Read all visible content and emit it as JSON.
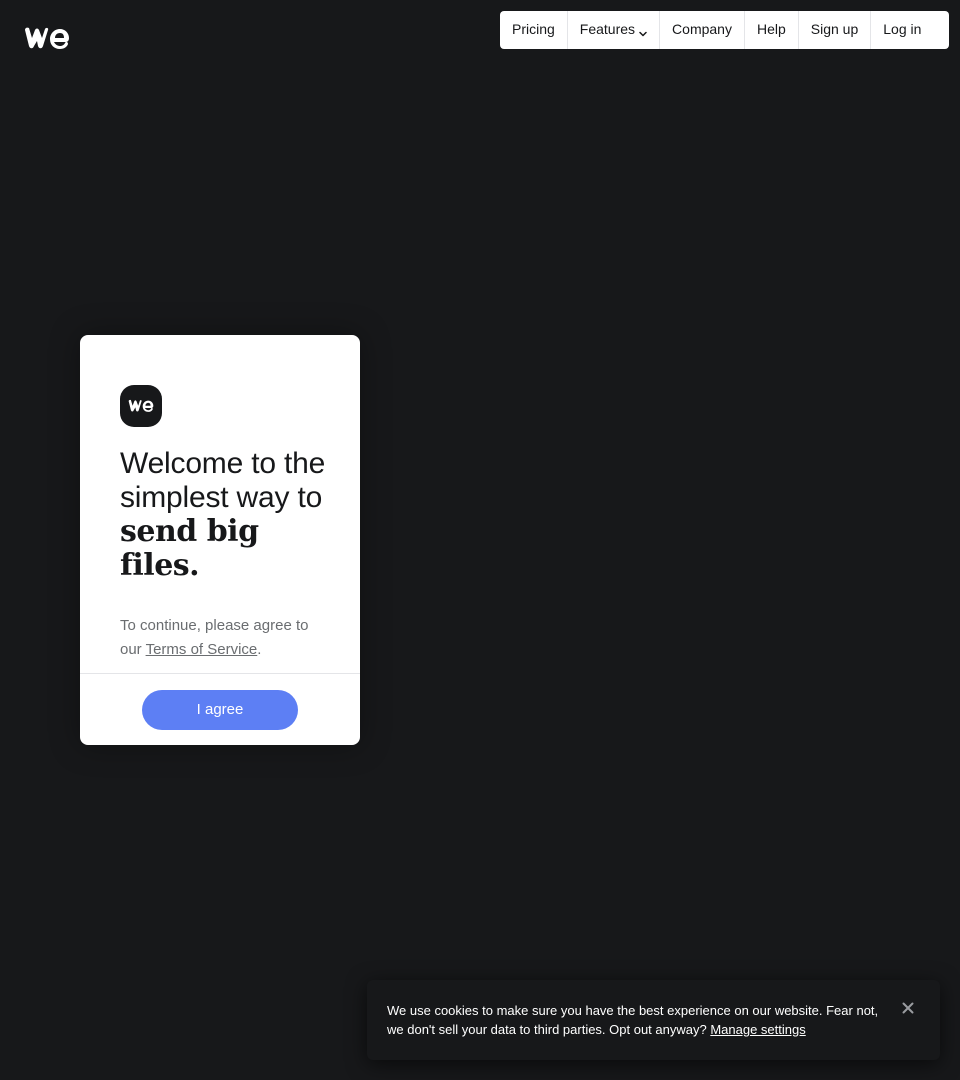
{
  "brand": {
    "logo_icon": "wetransfer-logo"
  },
  "nav": {
    "items": [
      {
        "label": "Pricing"
      },
      {
        "label": "Features",
        "has_dropdown": true
      },
      {
        "label": "Company"
      },
      {
        "label": "Help"
      },
      {
        "label": "Sign up"
      },
      {
        "label": "Log in"
      }
    ]
  },
  "welcome": {
    "title_regular": "Welcome to the simplest way to ",
    "title_bold": "send big files.",
    "agree_prefix": "To continue, please agree to our ",
    "terms_link": "Terms of Service",
    "agree_suffix": ".",
    "agree_button": "I agree"
  },
  "cookie": {
    "message": "We use cookies to make sure you have the best experience on our website. Fear not, we don't sell your data to third parties. Opt out anyway? ",
    "manage_link": "Manage settings",
    "close_icon": "close-icon"
  },
  "colors": {
    "background": "#17181a",
    "accent": "#5d7ff4",
    "card": "#ffffff"
  }
}
